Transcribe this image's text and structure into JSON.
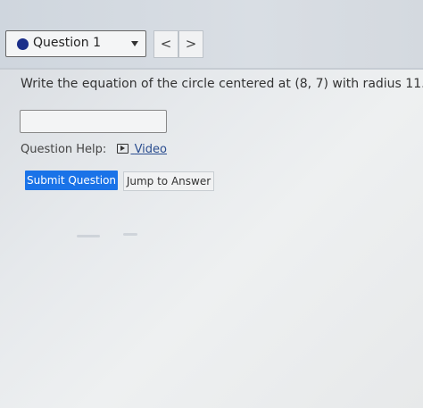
{
  "header": {
    "question_select": {
      "label": "Question 1",
      "status_color": "#1b2f8a"
    },
    "prev_label": "<",
    "next_label": ">"
  },
  "question": {
    "prompt": "Write the equation of the circle centered at (8, 7) with radius 11.",
    "answer_value": ""
  },
  "help": {
    "label": "Question Help:",
    "video_label": "Video",
    "video_icon": "play-video-icon"
  },
  "actions": {
    "submit_label": "Submit Question",
    "jump_label": "Jump to Answer"
  },
  "colors": {
    "primary": "#1a73e8",
    "link": "#2a4d8f"
  }
}
